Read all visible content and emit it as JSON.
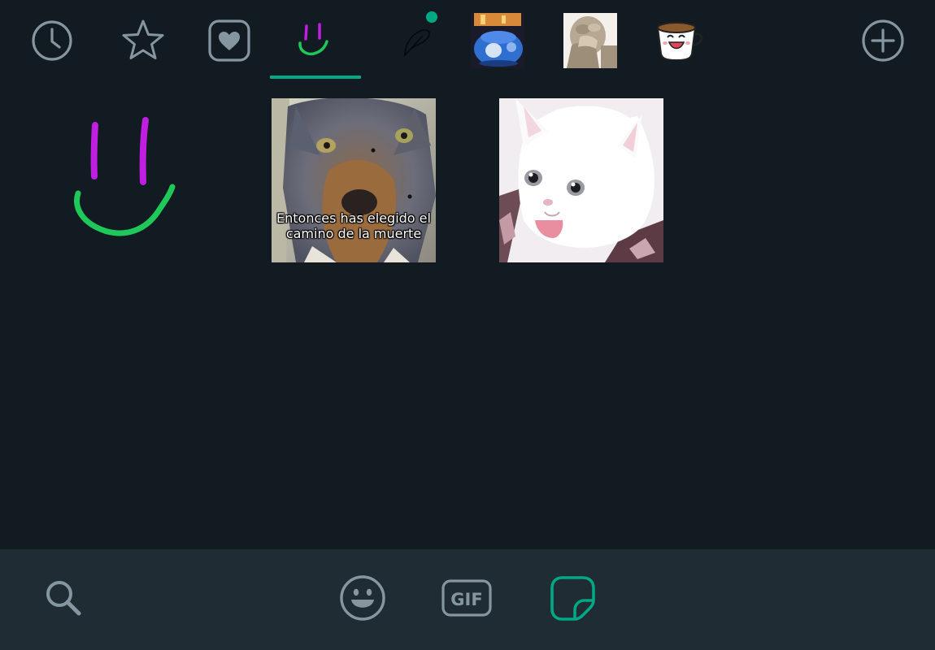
{
  "colors": {
    "background": "#111b21",
    "bottom_bar": "#1f2c34",
    "accent": "#00a884",
    "icon_gray": "#8696a0"
  },
  "tabs": [
    {
      "icon": "clock-icon",
      "name": "recent"
    },
    {
      "icon": "star-icon",
      "name": "favorites"
    },
    {
      "icon": "heart-icon",
      "name": "love"
    },
    {
      "icon": "smiley-doodle-icon",
      "name": "smiley-pack",
      "selected": true
    },
    {
      "icon": "sketch-leaf-icon",
      "name": "sketch-pack",
      "has_update": true
    },
    {
      "icon": "teapot-pack-icon",
      "name": "teapot-pack"
    },
    {
      "icon": "statue-facepalm-icon",
      "name": "statue-pack"
    },
    {
      "icon": "cup-face-icon",
      "name": "cup-pack"
    },
    {
      "icon": "add-circle-icon",
      "name": "add"
    }
  ],
  "stickers": [
    {
      "icon": "smiley-doodle-sticker",
      "caption": ""
    },
    {
      "icon": "wolf-meme-sticker",
      "caption": "Entonces has elegido el camino de la muerte"
    },
    {
      "icon": "white-cat-meme-sticker",
      "caption": ""
    }
  ],
  "bottom_bar": {
    "search_icon": "search-icon",
    "emoji_icon": "emoji-icon",
    "gif_label": "GIF",
    "sticker_icon": "sticker-icon",
    "active": "sticker"
  }
}
